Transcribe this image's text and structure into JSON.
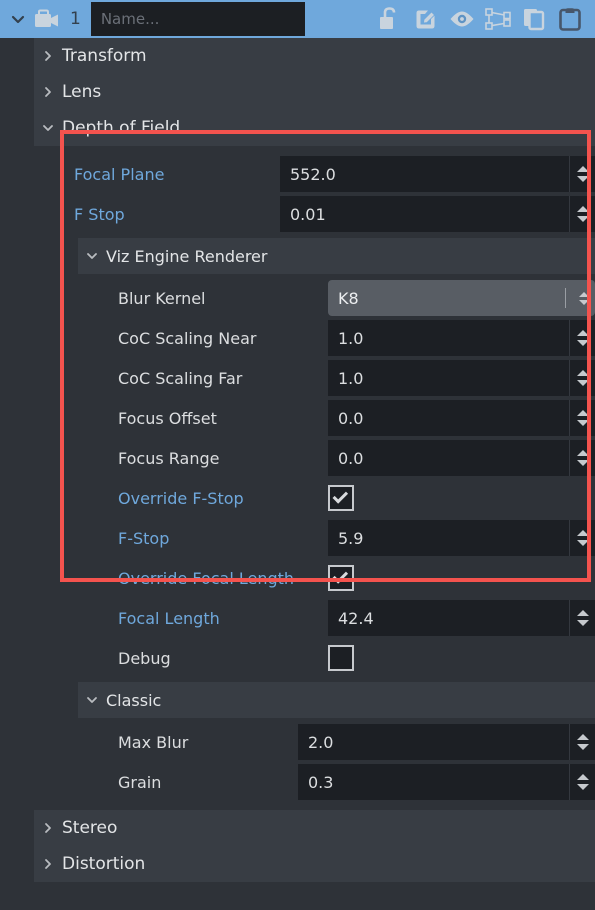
{
  "header": {
    "chevron_icon": "chevron-down-icon",
    "object_icon": "camera-icon",
    "object_number": "1",
    "name_value": "",
    "name_placeholder": "Name...",
    "icons": [
      {
        "name": "unlock-icon",
        "label": "Unlock"
      },
      {
        "name": "edit-icon",
        "label": "Edit"
      },
      {
        "name": "eye-icon",
        "label": "Visibility"
      },
      {
        "name": "transform-nodes-icon",
        "label": "Transform"
      },
      {
        "name": "copy-icon",
        "label": "Copy"
      },
      {
        "name": "paste-clipboard-icon",
        "label": "Paste"
      }
    ],
    "accent_color": "#6fa8dc"
  },
  "colors": {
    "panel_bg": "#2e3238",
    "group_bg": "#383d44",
    "field_bg": "#1c1f24",
    "combo_bg": "#585d64",
    "label": "#dcdee0",
    "animated_label": "#6fa8dc",
    "highlight_border": "#f4534e"
  },
  "groups": {
    "transform": {
      "label": "Transform",
      "twisty": "chevron-right-icon",
      "expanded": false
    },
    "lens": {
      "label": "Lens",
      "twisty": "chevron-right-icon",
      "expanded": false
    },
    "depth_of_field": {
      "label": "Depth of Field",
      "twisty": "chevron-down-icon",
      "expanded": true
    },
    "viz_engine_renderer": {
      "label": "Viz Engine Renderer",
      "twisty": "chevron-down-icon",
      "expanded": true
    },
    "classic": {
      "label": "Classic",
      "twisty": "chevron-down-icon",
      "expanded": true
    },
    "stereo": {
      "label": "Stereo",
      "twisty": "chevron-right-icon",
      "expanded": false
    },
    "distortion": {
      "label": "Distortion",
      "twisty": "chevron-right-icon",
      "expanded": false
    }
  },
  "dof": {
    "focal_plane": {
      "label": "Focal Plane",
      "value": "552.0",
      "animated": true
    },
    "f_stop": {
      "label": "F Stop",
      "value": "0.01",
      "animated": true
    }
  },
  "viz_engine_renderer": {
    "blur_kernel": {
      "label": "Blur Kernel",
      "value": "K8",
      "animated": false
    },
    "coc_scaling_near": {
      "label": "CoC Scaling Near",
      "value": "1.0",
      "animated": false
    },
    "coc_scaling_far": {
      "label": "CoC Scaling Far",
      "value": "1.0",
      "animated": false
    },
    "focus_offset": {
      "label": "Focus Offset",
      "value": "0.0",
      "animated": false
    },
    "focus_range": {
      "label": "Focus Range",
      "value": "0.0",
      "animated": false
    },
    "override_f_stop": {
      "label": "Override F-Stop",
      "checked": true,
      "animated": true
    },
    "f_stop": {
      "label": "F-Stop",
      "value": "5.9",
      "animated": true
    },
    "override_focal_length": {
      "label": "Override Focal Length",
      "checked": true,
      "animated": true
    },
    "focal_length": {
      "label": "Focal Length",
      "value": "42.4",
      "animated": true
    },
    "debug": {
      "label": "Debug",
      "checked": false,
      "animated": false
    }
  },
  "classic": {
    "max_blur": {
      "label": "Max Blur",
      "value": "2.0",
      "animated": false
    },
    "grain": {
      "label": "Grain",
      "value": "0.3",
      "animated": false
    }
  }
}
